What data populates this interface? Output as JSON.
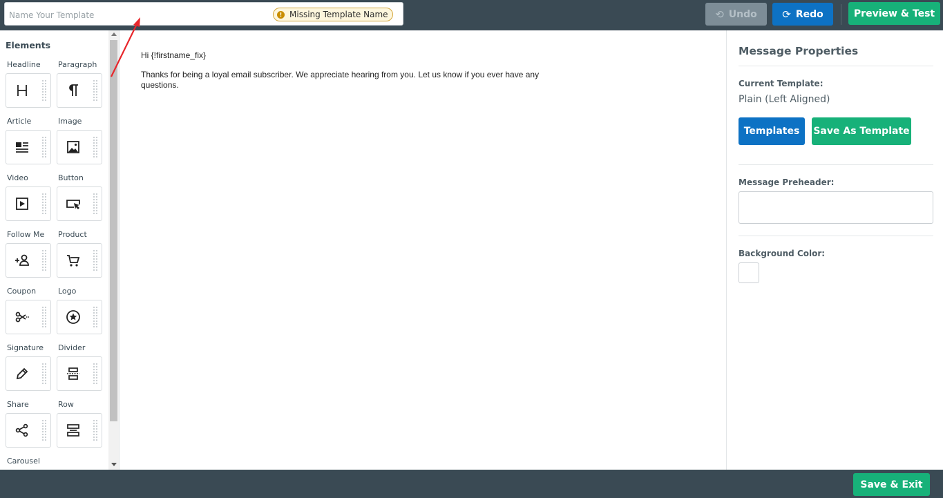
{
  "header": {
    "name_placeholder": "Name Your Template",
    "warning_badge": "Missing Template Name",
    "undo_label": "Undo",
    "redo_label": "Redo",
    "preview_label": "Preview & Test"
  },
  "sidebar": {
    "title": "Elements",
    "elements": [
      {
        "label": "Headline",
        "icon": "headline-icon"
      },
      {
        "label": "Paragraph",
        "icon": "paragraph-icon"
      },
      {
        "label": "Article",
        "icon": "article-icon"
      },
      {
        "label": "Image",
        "icon": "image-icon"
      },
      {
        "label": "Video",
        "icon": "video-icon"
      },
      {
        "label": "Button",
        "icon": "button-icon"
      },
      {
        "label": "Follow Me",
        "icon": "follow-me-icon"
      },
      {
        "label": "Product",
        "icon": "shopping-cart-icon"
      },
      {
        "label": "Coupon",
        "icon": "scissors-icon"
      },
      {
        "label": "Logo",
        "icon": "logo-star-icon"
      },
      {
        "label": "Signature",
        "icon": "pen-icon"
      },
      {
        "label": "Divider",
        "icon": "divider-icon"
      },
      {
        "label": "Share",
        "icon": "share-icon"
      },
      {
        "label": "Row",
        "icon": "row-icon"
      },
      {
        "label": "Carousel",
        "icon": "carousel-icon"
      }
    ]
  },
  "canvas": {
    "greeting": "Hi {!firstname_fix}",
    "body": "Thanks for being a loyal email subscriber. We appreciate hearing from you. Let us know if you ever have any questions."
  },
  "properties": {
    "title": "Message Properties",
    "current_template_label": "Current Template:",
    "current_template_value": "Plain (Left Aligned)",
    "templates_button": "Templates",
    "save_as_template_button": "Save As Template",
    "preheader_label": "Message Preheader:",
    "preheader_value": "",
    "background_color_label": "Background Color:",
    "background_color": "#ffffff"
  },
  "footer": {
    "save_exit_label": "Save & Exit"
  },
  "colors": {
    "topbar": "#3a4a54",
    "blue": "#0d72c4",
    "green": "#17b179",
    "annotation_arrow": "#e8262b"
  }
}
